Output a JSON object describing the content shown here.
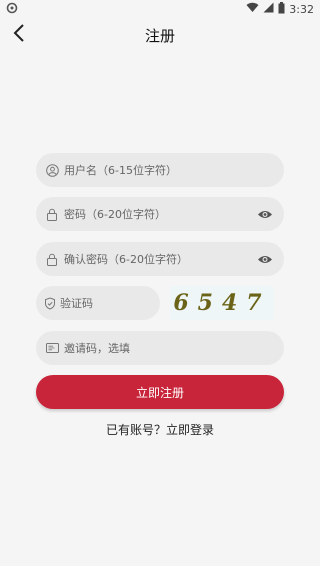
{
  "status_bar": {
    "time": "3:32",
    "icons": [
      "app-icon",
      "wifi-icon",
      "signal-icon",
      "battery-icon"
    ]
  },
  "header": {
    "title": "注册",
    "back_icon": "chevron-left-icon"
  },
  "form": {
    "username": {
      "placeholder": "用户名（6-15位字符）",
      "icon": "user-icon"
    },
    "password": {
      "placeholder": "密码（6-20位字符）",
      "icon": "lock-icon",
      "toggle_icon": "eye-icon"
    },
    "confirm_password": {
      "placeholder": "确认密码（6-20位字符）",
      "icon": "lock-icon",
      "toggle_icon": "eye-icon"
    },
    "captcha": {
      "placeholder": "验证码",
      "icon": "shield-icon",
      "code": "6547"
    },
    "invite": {
      "placeholder": "邀请码，选填",
      "icon": "invite-card-icon"
    }
  },
  "register_button": "立即注册",
  "login_link": "已有账号？立即登录",
  "colors": {
    "primary": "#c8243a",
    "field_bg": "#e9e9e9",
    "page_bg": "#f5f5f5",
    "captcha_text": "#6b6418"
  }
}
